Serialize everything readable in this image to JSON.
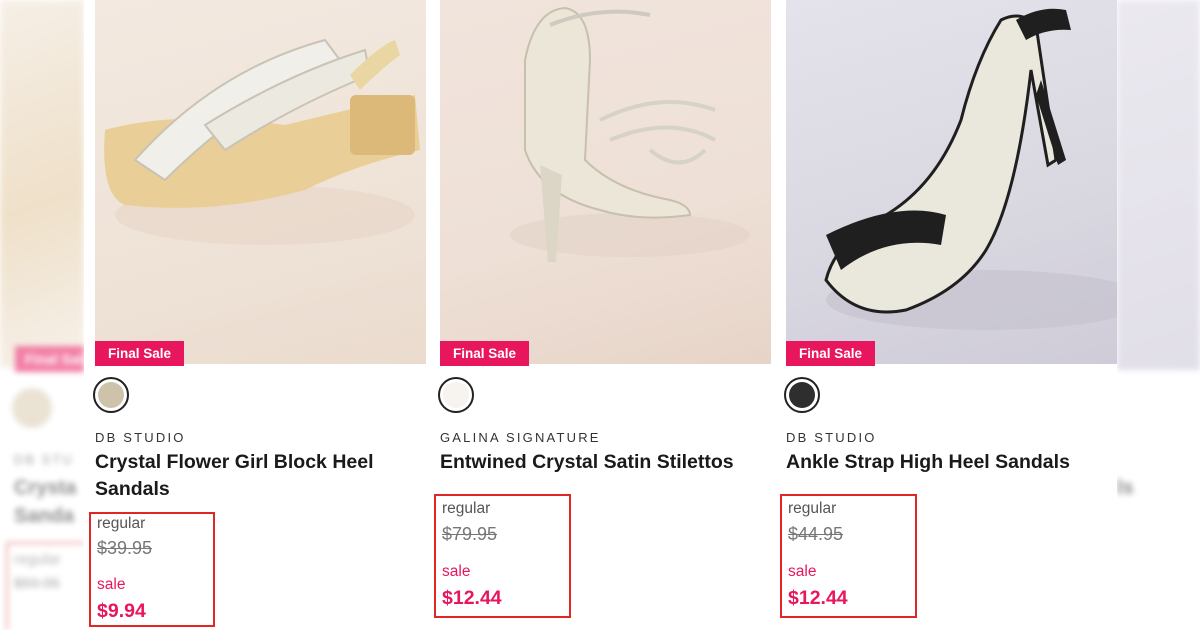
{
  "colors": {
    "sale_pink": "#e8175d",
    "highlight_red": "#e02626"
  },
  "ghost_left": {
    "badge": "Final Sale",
    "brand": "DB STU",
    "name_line1": "Crysta",
    "name_line2": "Sanda",
    "regular_label": "regular",
    "regular_price": "$59.95"
  },
  "ghost_right": {
    "name_tail": "ls"
  },
  "products": [
    {
      "badge": "Final Sale",
      "swatch_color": "#cfc2ab",
      "swatch_name": "champagne",
      "brand": "DB STUDIO",
      "name": "Crystal Flower Girl Block Heel Sandals",
      "regular_label": "regular",
      "regular_price": "$39.95",
      "sale_label": "sale",
      "sale_price": "$9.94"
    },
    {
      "badge": "Final Sale",
      "swatch_color": "#f7f3ef",
      "swatch_name": "ivory",
      "brand": "GALINA SIGNATURE",
      "name": "Entwined Crystal Satin Stilettos",
      "regular_label": "regular",
      "regular_price": "$79.95",
      "sale_label": "sale",
      "sale_price": "$12.44"
    },
    {
      "badge": "Final Sale",
      "swatch_color": "#2e2e2e",
      "swatch_name": "black",
      "brand": "DB STUDIO",
      "name": "Ankle Strap High Heel Sandals",
      "regular_label": "regular",
      "regular_price": "$44.95",
      "sale_label": "sale",
      "sale_price": "$12.44"
    }
  ]
}
